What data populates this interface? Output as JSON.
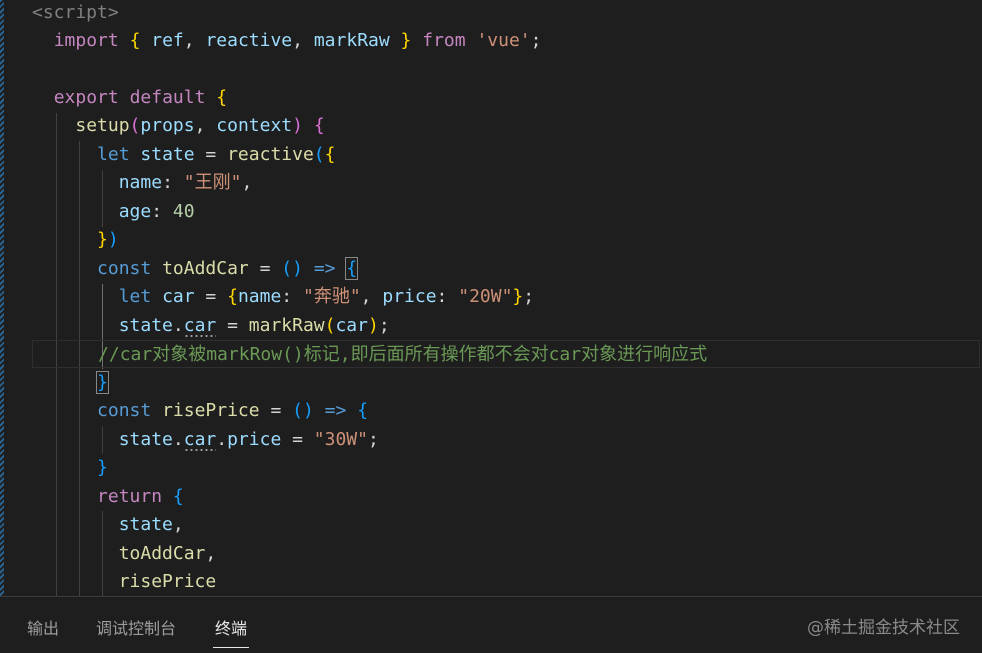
{
  "code": {
    "l1": [
      "<script>"
    ],
    "l2": [
      "import",
      " ",
      "{",
      " ",
      "ref",
      ", ",
      "reactive",
      ", ",
      "markRaw",
      " ",
      "}",
      " ",
      "from",
      " ",
      "'vue'",
      ";"
    ],
    "l4": [
      "export",
      " ",
      "default",
      " ",
      "{"
    ],
    "l5": [
      "setup",
      "(",
      "props",
      ", ",
      "context",
      ")",
      " ",
      "{"
    ],
    "l6": [
      "let",
      " ",
      "state",
      " = ",
      "reactive",
      "(",
      "{"
    ],
    "l7": [
      "name",
      ": ",
      "\"王刚\"",
      ","
    ],
    "l8": [
      "age",
      ": ",
      "40"
    ],
    "l9": [
      "}",
      ")"
    ],
    "l10": [
      "const",
      " ",
      "toAddCar",
      " = ",
      "(",
      ")",
      " ",
      "=>",
      " ",
      "{"
    ],
    "l11": [
      "let",
      " ",
      "car",
      " = ",
      "{",
      "name",
      ": ",
      "\"奔驰\"",
      ", ",
      "price",
      ": ",
      "\"20W\"",
      "}",
      ";"
    ],
    "l12": [
      "state",
      ".",
      "car",
      " = ",
      "markRaw",
      "(",
      "car",
      ")",
      ";"
    ],
    "l13": [
      "//car对象被markRow()标记,即后面所有操作都不会对car对象进行响应式"
    ],
    "l14": [
      "}"
    ],
    "l15": [
      "const",
      " ",
      "risePrice",
      " = ",
      "(",
      ")",
      " ",
      "=>",
      " ",
      "{"
    ],
    "l16": [
      "state",
      ".",
      "car",
      ".",
      "price",
      " = ",
      "\"30W\"",
      ";"
    ],
    "l17": [
      "}"
    ],
    "l18": [
      "return",
      " ",
      "{"
    ],
    "l19": [
      "state",
      ","
    ],
    "l20": [
      "toAddCar",
      ","
    ],
    "l21": [
      "risePrice"
    ]
  },
  "panel": {
    "tabs": [
      "输出",
      "调试控制台",
      "终端"
    ],
    "active_tab": "终端",
    "watermark": "@稀土掘金技术社区"
  },
  "colors": {
    "background": "#1e1e1e",
    "keyword": "#569cd6",
    "control_keyword": "#c586c0",
    "function": "#dcdcaa",
    "variable": "#9cdcfe",
    "string": "#ce9178",
    "number": "#b5cea8",
    "comment": "#6a9955",
    "bracket_level1": "#ffd700",
    "bracket_level2": "#da70d6",
    "bracket_level3": "#179fff"
  }
}
